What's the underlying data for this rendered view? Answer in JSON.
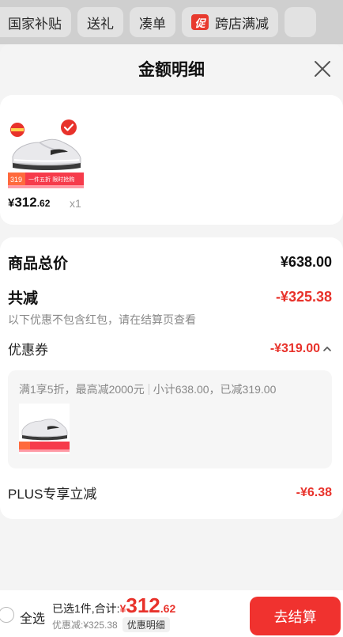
{
  "top_tabs": [
    {
      "label": "国家补贴"
    },
    {
      "label": "送礼"
    },
    {
      "label": "凑单"
    },
    {
      "label": "跨店满减",
      "badge": "促"
    }
  ],
  "sheet": {
    "title": "金额明细"
  },
  "product": {
    "price_yen": "¥",
    "price_int": "312",
    "price_dec": ".62",
    "quantity": "x1",
    "thumb_tag_price": "319",
    "thumb_tag_text": "一件五折 限时抢购"
  },
  "details": {
    "total_label": "商品总价",
    "total_value": "¥638.00",
    "reduce_label": "共减",
    "reduce_value": "-¥325.38",
    "note": "以下优惠不包含红包，请在结算页查看",
    "coupon_label": "优惠券",
    "coupon_value": "-¥319.00",
    "coupon_desc_left": "满1享5折，最高减2000元",
    "coupon_desc_right": "小计638.00，已减319.00",
    "plus_label": "PLUS专享立减",
    "plus_value": "-¥6.38"
  },
  "bottom": {
    "select_all": "全选",
    "selected_text": "已选1件,合计:",
    "total_yen": "¥",
    "total_int": "312",
    "total_dec": ".62",
    "discount_text": "优惠减:¥325.38",
    "detail_link": "优惠明细",
    "checkout": "去结算"
  },
  "colors": {
    "accent_red": "#e8322b",
    "checkout_red": "#f0322f"
  },
  "icons": [
    "close-icon",
    "check-icon",
    "chevron-up-icon",
    "radio-icon",
    "promo-badge-icon"
  ]
}
